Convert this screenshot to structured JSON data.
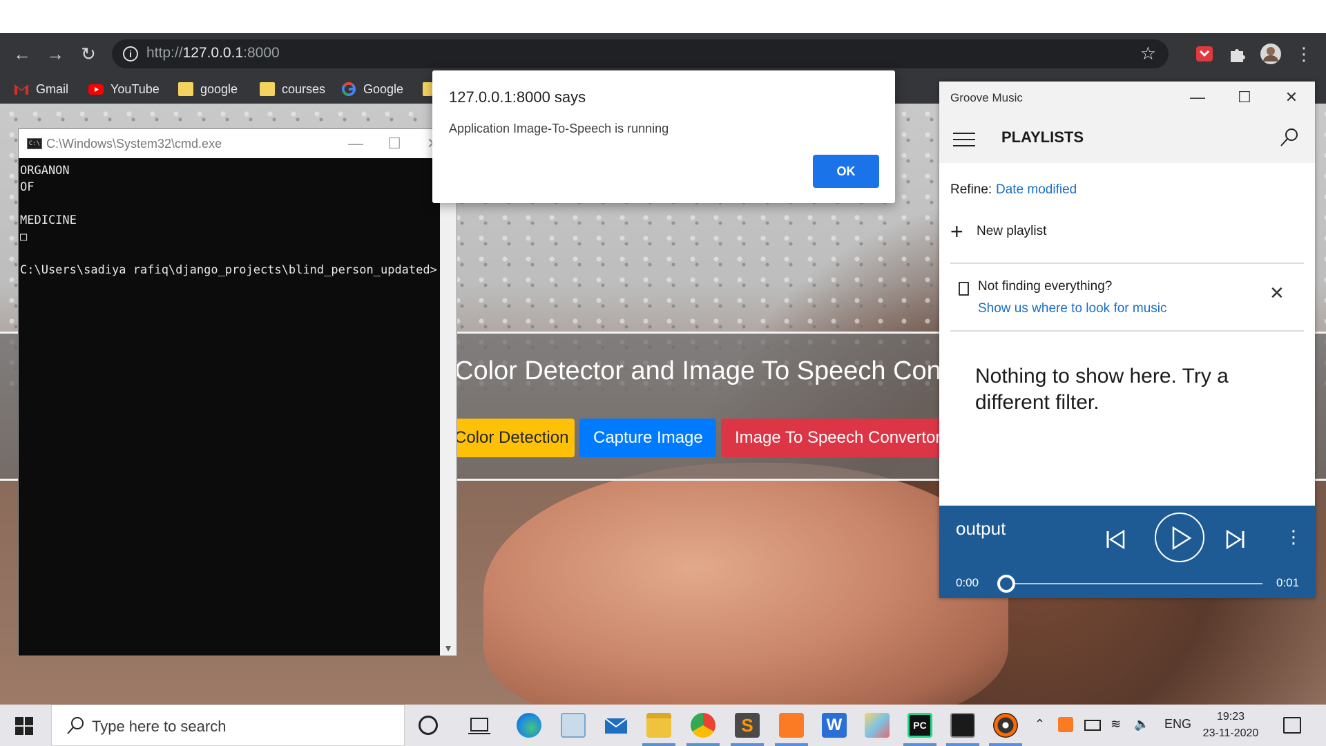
{
  "browser": {
    "url_prefix": "http://",
    "url_host": "127.0.0.1",
    "url_port": ":8000",
    "bookmarks": [
      "Gmail",
      "YouTube",
      "google",
      "courses",
      "Google"
    ]
  },
  "site": {
    "title": "Color Detector and Image To Speech Convertor",
    "buttons": [
      "Color Detection",
      "Capture Image",
      "Image To Speech Convertor"
    ]
  },
  "cmd": {
    "title": "C:\\Windows\\System32\\cmd.exe",
    "output": "ORGANON\nOF\n\nMEDICINE\n□\n\nC:\\Users\\sadiya rafiq\\django_projects\\blind_person_updated>"
  },
  "alert": {
    "title": "127.0.0.1:8000 says",
    "message": "Application Image-To-Speech is running",
    "ok_label": "OK"
  },
  "groove": {
    "window_title": "Groove Music",
    "heading": "PLAYLISTS",
    "refine_label": "Refine:",
    "refine_value": "Date modified",
    "new_playlist": "New playlist",
    "not_finding": "Not finding everything?",
    "show_link": "Show us where to look for music",
    "empty_message": "Nothing to show here. Try a different filter.",
    "now_playing": "output",
    "time_elapsed": "0:00",
    "time_total": "0:01",
    "progress": 0
  },
  "taskbar": {
    "search_placeholder": "Type here to search",
    "language": "ENG",
    "time": "19:23",
    "date": "23-11-2020"
  }
}
